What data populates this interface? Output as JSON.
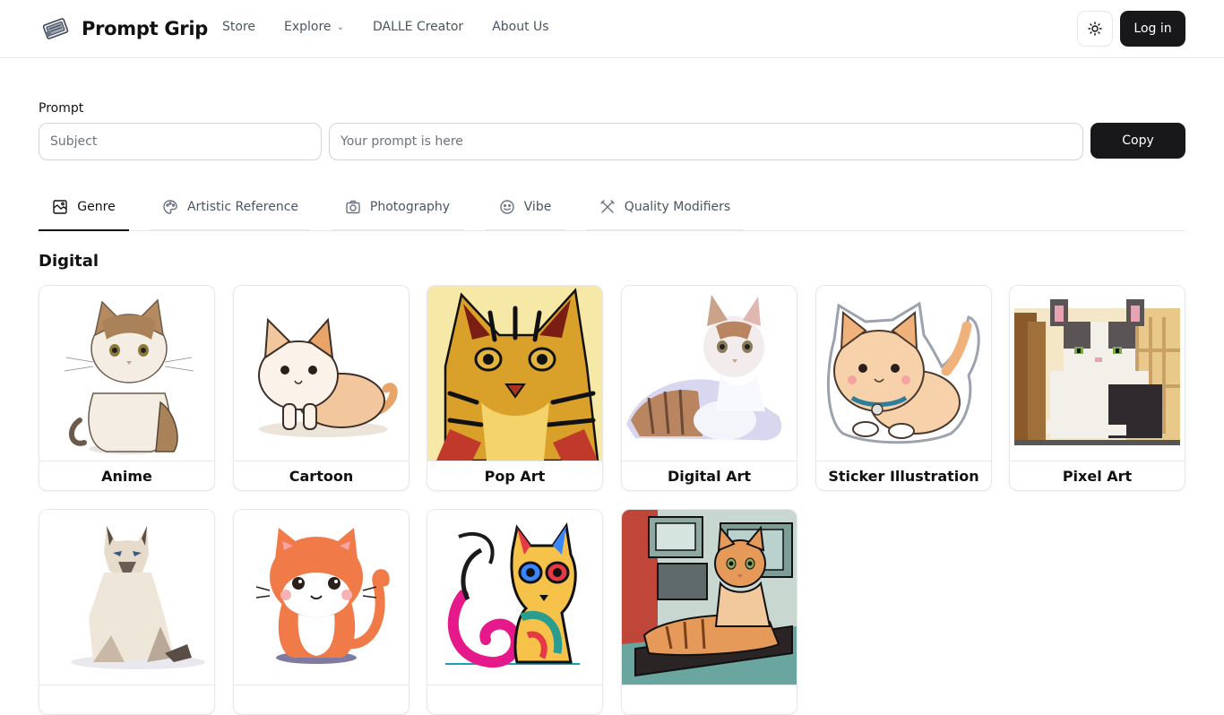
{
  "header": {
    "logo_text": "Prompt Grip",
    "nav": [
      {
        "label": "Store"
      },
      {
        "label": "Explore"
      },
      {
        "label": "DALLE Creator"
      },
      {
        "label": "About Us"
      }
    ],
    "login_label": "Log in"
  },
  "prompt": {
    "label": "Prompt",
    "subject_placeholder": "Subject",
    "prompt_placeholder": "Your prompt is here",
    "copy_label": "Copy"
  },
  "tabs": [
    {
      "label": "Genre",
      "icon": "genre-icon",
      "active": true
    },
    {
      "label": "Artistic Reference",
      "icon": "palette-icon",
      "active": false
    },
    {
      "label": "Photography",
      "icon": "camera-icon",
      "active": false
    },
    {
      "label": "Vibe",
      "icon": "smile-icon",
      "active": false
    },
    {
      "label": "Quality Modifiers",
      "icon": "tools-icon",
      "active": false
    }
  ],
  "section": {
    "title": "Digital"
  },
  "cards": [
    {
      "label": "Anime"
    },
    {
      "label": "Cartoon"
    },
    {
      "label": "Pop Art"
    },
    {
      "label": "Digital Art"
    },
    {
      "label": "Sticker Illustration"
    },
    {
      "label": "Pixel Art"
    },
    {
      "label": ""
    },
    {
      "label": ""
    },
    {
      "label": ""
    },
    {
      "label": ""
    }
  ]
}
